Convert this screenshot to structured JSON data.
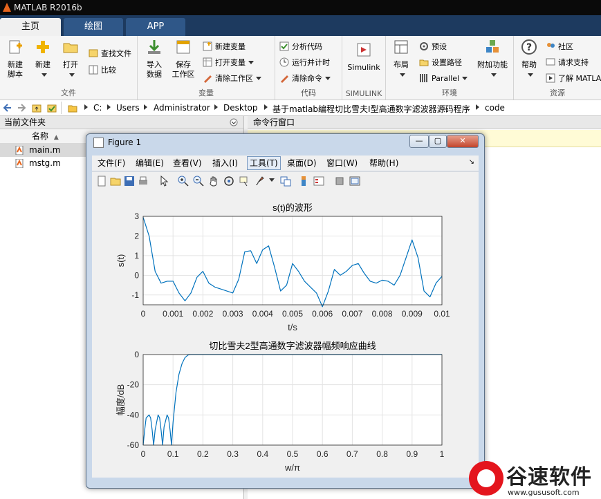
{
  "app": {
    "title": "MATLAB R2016b"
  },
  "tabs": [
    {
      "label": "主页",
      "active": true
    },
    {
      "label": "绘图",
      "active": false
    },
    {
      "label": "APP",
      "active": false
    }
  ],
  "ribbon": {
    "file": {
      "label": "文件",
      "new_script": "新建\n脚本",
      "new": "新建",
      "open": "打开",
      "find_files": "查找文件",
      "compare": "比较"
    },
    "variable": {
      "label": "变量",
      "import": "导入\n数据",
      "save_ws": "保存\n工作区",
      "new_var": "新建变量",
      "open_var": "打开变量",
      "clear_ws": "清除工作区"
    },
    "code": {
      "label": "代码",
      "analyze": "分析代码",
      "run_time": "运行并计时",
      "clear_cmd": "清除命令"
    },
    "simulink": {
      "label": "SIMULINK",
      "button": "Simulink"
    },
    "env": {
      "label": "环境",
      "layout": "布局",
      "prefs": "预设",
      "set_path": "设置路径",
      "parallel": "Parallel",
      "addons": "附加功能"
    },
    "resources": {
      "label": "资源",
      "help": "帮助",
      "community": "社区",
      "support": "请求支持",
      "learn": "了解 MATLAB"
    }
  },
  "address": {
    "crumbs": [
      "C:",
      "Users",
      "Administrator",
      "Desktop",
      "基于matlab编程切比雪夫I型高通数字滤波器源码程序",
      "code"
    ]
  },
  "current_folder": {
    "title": "当前文件夹",
    "col_name": "名称",
    "files": [
      "main.m",
      "mstg.m"
    ]
  },
  "command_window": {
    "title": "命令行窗口"
  },
  "figure": {
    "title": "Figure 1",
    "menu": [
      "文件(F)",
      "编辑(E)",
      "查看(V)",
      "插入(I)",
      "工具(T)",
      "桌面(D)",
      "窗口(W)",
      "帮助(H)"
    ],
    "active_menu": "工具(T)"
  },
  "chart_data": [
    {
      "type": "line",
      "title": "s(t)的波形",
      "xlabel": "t/s",
      "ylabel": "s(t)",
      "xlim": [
        0,
        0.01
      ],
      "ylim": [
        -1.5,
        3
      ],
      "xticks": [
        "0",
        "0.001",
        "0.002",
        "0.003",
        "0.004",
        "0.005",
        "0.006",
        "0.007",
        "0.008",
        "0.009",
        "0.01"
      ],
      "yticks": [
        "-1",
        "0",
        "1",
        "2",
        "3"
      ],
      "grid": true,
      "x": [
        0,
        0.0002,
        0.0004,
        0.0006,
        0.0008,
        0.001,
        0.0012,
        0.0014,
        0.0016,
        0.0018,
        0.002,
        0.0022,
        0.0024,
        0.0026,
        0.0028,
        0.003,
        0.0032,
        0.0034,
        0.0036,
        0.0038,
        0.004,
        0.0042,
        0.0044,
        0.0046,
        0.0048,
        0.005,
        0.0052,
        0.0054,
        0.0056,
        0.0058,
        0.006,
        0.0062,
        0.0064,
        0.0066,
        0.0068,
        0.007,
        0.0072,
        0.0074,
        0.0076,
        0.0078,
        0.008,
        0.0082,
        0.0084,
        0.0086,
        0.0088,
        0.009,
        0.0092,
        0.0094,
        0.0096,
        0.0098,
        0.01
      ],
      "y": [
        2.95,
        2.0,
        0.2,
        -0.4,
        -0.3,
        -0.3,
        -0.9,
        -1.3,
        -0.9,
        -0.1,
        0.2,
        -0.4,
        -0.6,
        -0.7,
        -0.8,
        -0.9,
        -0.2,
        1.2,
        1.25,
        0.6,
        1.3,
        1.5,
        0.4,
        -0.8,
        -0.5,
        0.6,
        0.2,
        -0.3,
        -0.6,
        -0.9,
        -1.6,
        -0.8,
        0.3,
        0.0,
        0.2,
        0.5,
        0.6,
        0.1,
        -0.3,
        -0.4,
        -0.25,
        -0.3,
        -0.5,
        0.0,
        0.9,
        1.8,
        0.9,
        -0.8,
        -1.1,
        -0.4,
        -0.05
      ]
    },
    {
      "type": "line",
      "title": "切比雪夫2型高通数字滤波器幅频响应曲线",
      "xlabel": "w/π",
      "ylabel": "幅度/dB",
      "xlim": [
        0,
        1
      ],
      "ylim": [
        -60,
        0
      ],
      "xticks": [
        "0",
        "0.1",
        "0.2",
        "0.3",
        "0.4",
        "0.5",
        "0.6",
        "0.7",
        "0.8",
        "0.9",
        "1"
      ],
      "yticks": [
        "-60",
        "-40",
        "-20",
        "0"
      ],
      "grid": true,
      "x": [
        0,
        0.005,
        0.01,
        0.02,
        0.025,
        0.03,
        0.035,
        0.04,
        0.05,
        0.055,
        0.06,
        0.065,
        0.07,
        0.08,
        0.085,
        0.09,
        0.095,
        0.1,
        0.11,
        0.12,
        0.13,
        0.14,
        0.15,
        0.16,
        0.2,
        0.4,
        0.6,
        0.8,
        1.0
      ],
      "y": [
        -60,
        -50,
        -42,
        -40,
        -42,
        -50,
        -60,
        -50,
        -40,
        -42,
        -50,
        -60,
        -48,
        -40,
        -42,
        -50,
        -60,
        -45,
        -25,
        -13,
        -6,
        -2,
        -0.3,
        0,
        0,
        0,
        0,
        0,
        0
      ]
    }
  ],
  "watermark": {
    "name": "谷速软件",
    "url": "www.gususoft.com"
  }
}
